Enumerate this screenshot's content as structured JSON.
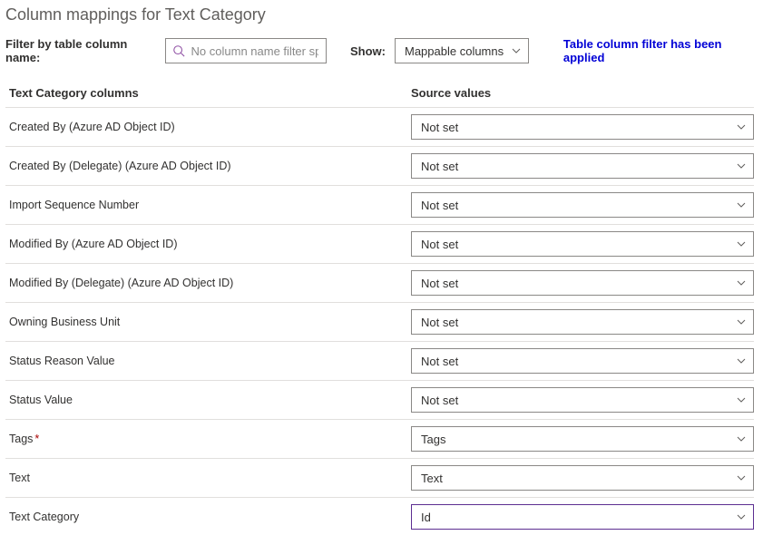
{
  "title": "Column mappings for Text Category",
  "filter": {
    "label": "Filter by table column name:",
    "placeholder": "No column name filter sp..."
  },
  "show": {
    "label": "Show:",
    "value": "Mappable columns"
  },
  "notice": "Table column filter has been applied",
  "headers": {
    "left": "Text Category columns",
    "right": "Source values"
  },
  "rows": [
    {
      "name": "Created By (Azure AD Object ID)",
      "value": "Not set",
      "required": false,
      "focused": false
    },
    {
      "name": "Created By (Delegate) (Azure AD Object ID)",
      "value": "Not set",
      "required": false,
      "focused": false
    },
    {
      "name": "Import Sequence Number",
      "value": "Not set",
      "required": false,
      "focused": false
    },
    {
      "name": "Modified By (Azure AD Object ID)",
      "value": "Not set",
      "required": false,
      "focused": false
    },
    {
      "name": "Modified By (Delegate) (Azure AD Object ID)",
      "value": "Not set",
      "required": false,
      "focused": false
    },
    {
      "name": "Owning Business Unit",
      "value": "Not set",
      "required": false,
      "focused": false
    },
    {
      "name": "Status Reason Value",
      "value": "Not set",
      "required": false,
      "focused": false
    },
    {
      "name": "Status Value",
      "value": "Not set",
      "required": false,
      "focused": false
    },
    {
      "name": "Tags",
      "value": "Tags",
      "required": true,
      "focused": false
    },
    {
      "name": "Text",
      "value": "Text",
      "required": false,
      "focused": false
    },
    {
      "name": "Text Category",
      "value": "Id",
      "required": false,
      "focused": true
    }
  ]
}
